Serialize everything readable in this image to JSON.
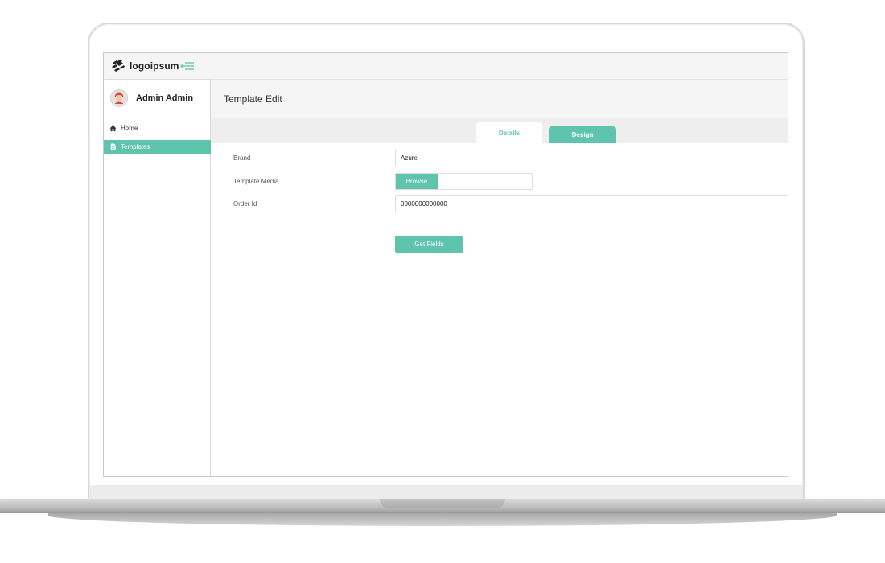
{
  "app": {
    "logo_text": "logoipsum",
    "logo_mark": "™"
  },
  "user": {
    "name": "Admin Admin",
    "avatar_icon": "user-avatar-icon"
  },
  "sidebar": {
    "items": [
      {
        "label": "Home",
        "icon": "home-icon",
        "active": false
      },
      {
        "label": "Templates",
        "icon": "file-icon",
        "active": true
      }
    ]
  },
  "page": {
    "title": "Template Edit"
  },
  "tabs": [
    {
      "label": "Details",
      "active": true
    },
    {
      "label": "Design",
      "active": false
    }
  ],
  "form": {
    "brand_label": "Brand",
    "brand_value": "Azure",
    "media_label": "Template Media",
    "browse_label": "Browse",
    "order_label": "Order Id",
    "order_value": "0000000000000",
    "get_fields_label": "Get Fields"
  },
  "colors": {
    "accent": "#5fc4ad",
    "header_bg": "#f5f5f5"
  }
}
